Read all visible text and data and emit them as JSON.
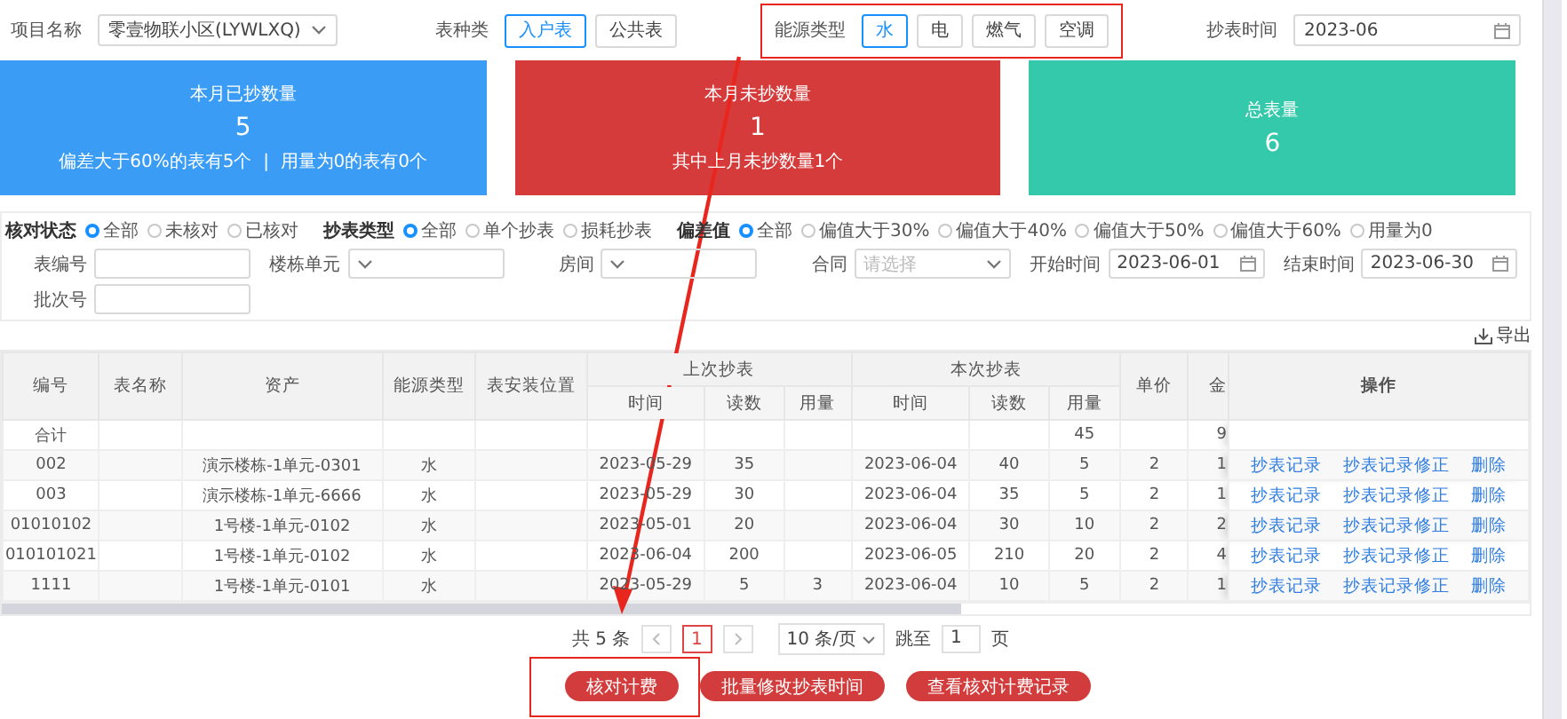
{
  "top_bar": {
    "project": {
      "label": "项目名称",
      "value": "零壹物联小区(LYWLXQ)"
    },
    "meter_kind": {
      "label": "表种类",
      "options": [
        {
          "label": "入户表",
          "selected": true
        },
        {
          "label": "公共表",
          "selected": false
        }
      ]
    },
    "energy_type": {
      "label": "能源类型",
      "options": [
        {
          "label": "水",
          "selected": true
        },
        {
          "label": "电",
          "selected": false
        },
        {
          "label": "燃气",
          "selected": false
        },
        {
          "label": "空调",
          "selected": false
        }
      ]
    },
    "read_time": {
      "label": "抄表时间",
      "value": "2023-06"
    }
  },
  "cards": [
    {
      "title": "本月已抄数量",
      "value": "5",
      "note": "偏差大于60%的表有5个  |  用量为0的表有0个",
      "color": "#3a9cf5"
    },
    {
      "title": "本月未抄数量",
      "value": "1",
      "note": "其中上月未抄数量1个",
      "color": "#d63b3b"
    },
    {
      "title": "总表量",
      "value": "6",
      "color": "#34c9aa"
    }
  ],
  "filters": {
    "radio_groups": [
      {
        "label": "核对状态",
        "options": [
          {
            "label": "全部",
            "selected": true
          },
          {
            "label": "未核对",
            "selected": false
          },
          {
            "label": "已核对",
            "selected": false
          }
        ]
      },
      {
        "label": "抄表类型",
        "options": [
          {
            "label": "全部",
            "selected": true
          },
          {
            "label": "单个抄表",
            "selected": false
          },
          {
            "label": "损耗抄表",
            "selected": false
          }
        ]
      },
      {
        "label": "偏差值",
        "options": [
          {
            "label": "全部",
            "selected": true
          },
          {
            "label": "偏值大于30%",
            "selected": false
          },
          {
            "label": "偏值大于40%",
            "selected": false
          },
          {
            "label": "偏值大于50%",
            "selected": false
          },
          {
            "label": "偏值大于60%",
            "selected": false
          },
          {
            "label": "用量为0",
            "selected": false
          }
        ]
      }
    ],
    "fields": [
      {
        "label": "表编号",
        "kind": "text"
      },
      {
        "label": "楼栋单元",
        "kind": "select"
      },
      {
        "label": "房间",
        "kind": "select"
      },
      {
        "label": "合同",
        "kind": "select",
        "placeholder": "请选择"
      },
      {
        "label": "开始时间",
        "kind": "date",
        "value": "2023-06-01"
      },
      {
        "label": "结束时间",
        "kind": "date",
        "value": "2023-06-30"
      },
      {
        "label": "批次号",
        "kind": "text"
      }
    ]
  },
  "export_label": "导出",
  "table": {
    "columns": [
      {
        "label": "编号"
      },
      {
        "label": "表名称"
      },
      {
        "label": "资产"
      },
      {
        "label": "能源类型"
      },
      {
        "label": "表安装位置"
      },
      {
        "label": "上次抄表",
        "children": [
          "时间",
          "读数",
          "用量"
        ]
      },
      {
        "label": "本次抄表",
        "children": [
          "时间",
          "读数",
          "用量"
        ]
      },
      {
        "label": "单价"
      },
      {
        "label": "金"
      },
      {
        "label": "操作"
      }
    ],
    "rows": [
      {
        "code": "合计",
        "cur_usage": "45",
        "amount": "9"
      },
      {
        "code": "002",
        "asset": "演示楼栋-1单元-0301",
        "energy": "水",
        "prev_time": "2023-05-29",
        "prev_reading": "35",
        "cur_time": "2023-06-04",
        "cur_reading": "40",
        "cur_usage": "5",
        "price": "2",
        "amount": "1",
        "actions": [
          "抄表记录",
          "抄表记录修正",
          "删除"
        ]
      },
      {
        "code": "003",
        "asset": "演示楼栋-1单元-6666",
        "energy": "水",
        "prev_time": "2023-05-29",
        "prev_reading": "30",
        "cur_time": "2023-06-04",
        "cur_reading": "35",
        "cur_usage": "5",
        "price": "2",
        "amount": "1",
        "actions": [
          "抄表记录",
          "抄表记录修正",
          "删除"
        ]
      },
      {
        "code": "01010102",
        "asset": "1号楼-1单元-0102",
        "energy": "水",
        "prev_time": "2023-05-01",
        "prev_reading": "20",
        "cur_time": "2023-06-04",
        "cur_reading": "30",
        "cur_usage": "10",
        "price": "2",
        "amount": "2",
        "actions": [
          "抄表记录",
          "抄表记录修正",
          "删除"
        ]
      },
      {
        "code": "010101021",
        "asset": "1号楼-1单元-0102",
        "energy": "水",
        "prev_time": "2023-06-04",
        "prev_reading": "200",
        "cur_time": "2023-06-05",
        "cur_reading": "210",
        "cur_usage": "20",
        "price": "2",
        "amount": "4",
        "actions": [
          "抄表记录",
          "抄表记录修正",
          "删除"
        ]
      },
      {
        "code": "1111",
        "asset": "1号楼-1单元-0101",
        "energy": "水",
        "prev_time": "2023-05-29",
        "prev_reading": "5",
        "prev_usage": "3",
        "cur_time": "2023-06-04",
        "cur_reading": "10",
        "cur_usage": "5",
        "price": "2",
        "amount": "1",
        "actions": [
          "抄表记录",
          "抄表记录修正",
          "删除"
        ]
      }
    ]
  },
  "pagination": {
    "total": "共 5 条",
    "pages": [
      {
        "label": "1",
        "selected": true
      }
    ],
    "page_size": "10 条/页",
    "jump_label": "跳至",
    "jump_value": "1",
    "page_suffix": "页"
  },
  "actions": [
    "核对计费",
    "批量修改抄表时间",
    "查看核对计费记录"
  ]
}
